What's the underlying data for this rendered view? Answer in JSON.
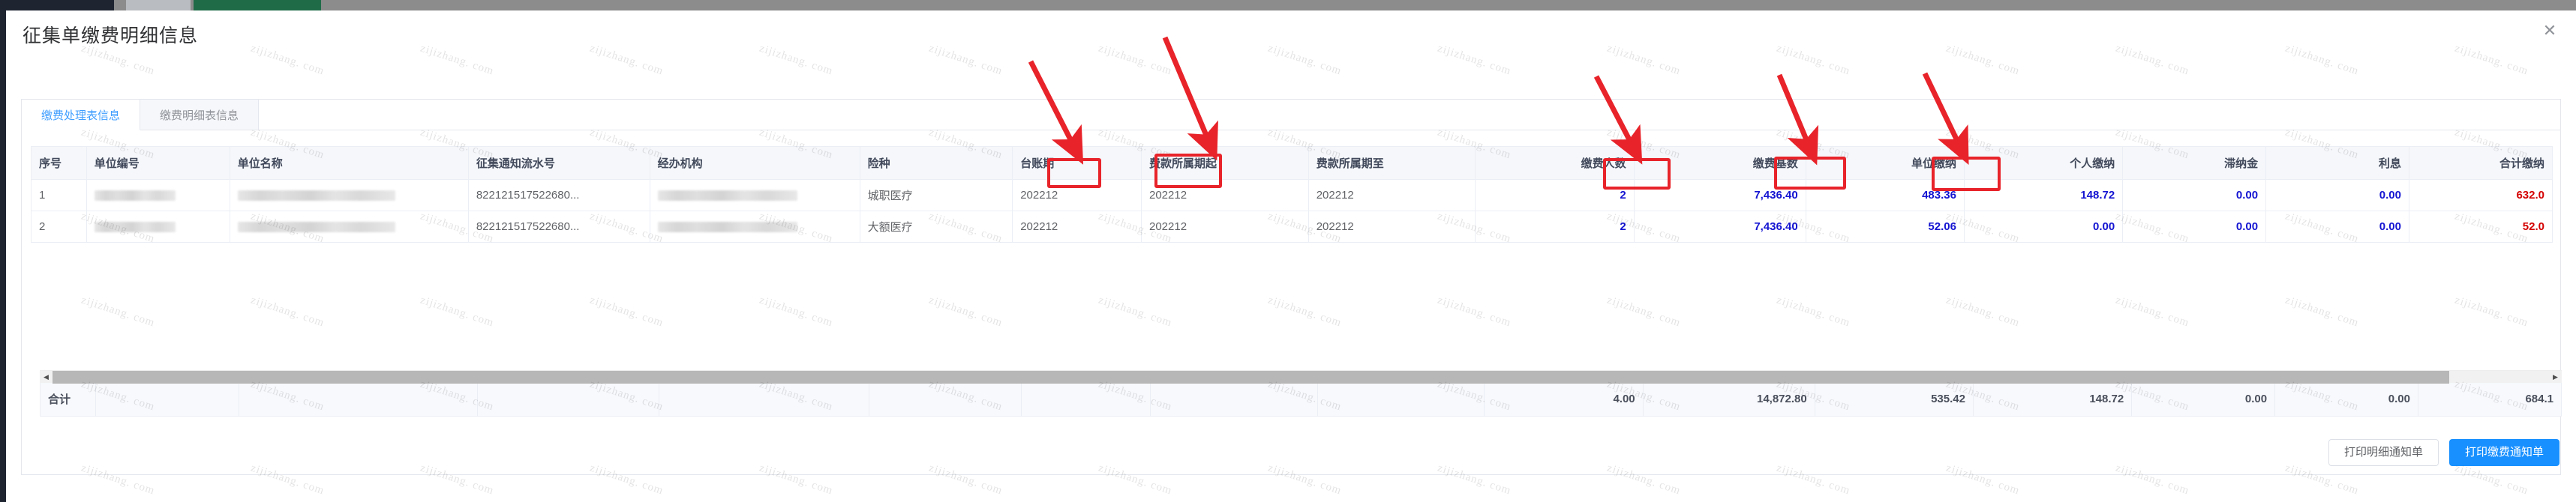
{
  "dialog": {
    "title": "征集单缴费明细信息",
    "close_label": "✕"
  },
  "tabs": [
    {
      "label": "缴费处理表信息",
      "active": true
    },
    {
      "label": "缴费明细表信息",
      "active": false
    }
  ],
  "table": {
    "columns": [
      {
        "key": "seq",
        "label": "序号",
        "align": "left"
      },
      {
        "key": "unit_code",
        "label": "单位编号",
        "align": "left"
      },
      {
        "key": "unit_name",
        "label": "单位名称",
        "align": "left"
      },
      {
        "key": "notice_no",
        "label": "征集通知流水号",
        "align": "left"
      },
      {
        "key": "agency",
        "label": "经办机构",
        "align": "left"
      },
      {
        "key": "insurance",
        "label": "险种",
        "align": "left"
      },
      {
        "key": "ledger",
        "label": "台账期",
        "align": "left"
      },
      {
        "key": "period_from",
        "label": "费款所属期起",
        "align": "left"
      },
      {
        "key": "period_to",
        "label": "费款所属期至",
        "align": "left"
      },
      {
        "key": "people",
        "label": "缴费人数",
        "align": "right"
      },
      {
        "key": "base",
        "label": "缴费基数",
        "align": "right"
      },
      {
        "key": "unit_pay",
        "label": "单位缴纳",
        "align": "right"
      },
      {
        "key": "person_pay",
        "label": "个人缴纳",
        "align": "right"
      },
      {
        "key": "late_fee",
        "label": "滞纳金",
        "align": "right"
      },
      {
        "key": "interest",
        "label": "利息",
        "align": "right"
      },
      {
        "key": "total_pay",
        "label": "合计缴纳",
        "align": "right"
      }
    ],
    "rows": [
      {
        "seq": "1",
        "unit_code": "",
        "unit_name": "",
        "notice_no": "822121517522680...",
        "agency": "",
        "insurance": "城职医疗",
        "ledger": "202212",
        "period_from": "202212",
        "period_to": "202212",
        "people": "2",
        "base": "7,436.40",
        "unit_pay": "483.36",
        "person_pay": "148.72",
        "late_fee": "0.00",
        "interest": "0.00",
        "total_pay": "632.0"
      },
      {
        "seq": "2",
        "unit_code": "",
        "unit_name": "",
        "notice_no": "822121517522680...",
        "agency": "",
        "insurance": "大额医疗",
        "ledger": "202212",
        "period_from": "202212",
        "period_to": "202212",
        "people": "2",
        "base": "7,436.40",
        "unit_pay": "52.06",
        "person_pay": "0.00",
        "late_fee": "0.00",
        "interest": "0.00",
        "total_pay": "52.0"
      }
    ],
    "summary": {
      "label": "合计",
      "people": "4.00",
      "base": "14,872.80",
      "unit_pay": "535.42",
      "person_pay": "148.72",
      "late_fee": "0.00",
      "interest": "0.00",
      "total_pay": "684.1"
    }
  },
  "scrollbar": {
    "left_arrow": "◀",
    "right_arrow": "▶"
  },
  "footer": {
    "detail_button": "打印明细通知单",
    "payment_button": "打印缴费通知单"
  },
  "annotations": {
    "color": "#e8232a",
    "highlighted_columns": [
      "险种",
      "台账期",
      "缴费人数",
      "缴费基数",
      "单位缴纳"
    ],
    "arrow_count": 5
  },
  "watermark": {
    "text": "zijizhang. com"
  },
  "colors": {
    "accent": "#409eff",
    "primary_button": "#1890ff",
    "annotation_red": "#e8232a",
    "value_blue": "#1414d2",
    "value_red": "#d40000"
  }
}
